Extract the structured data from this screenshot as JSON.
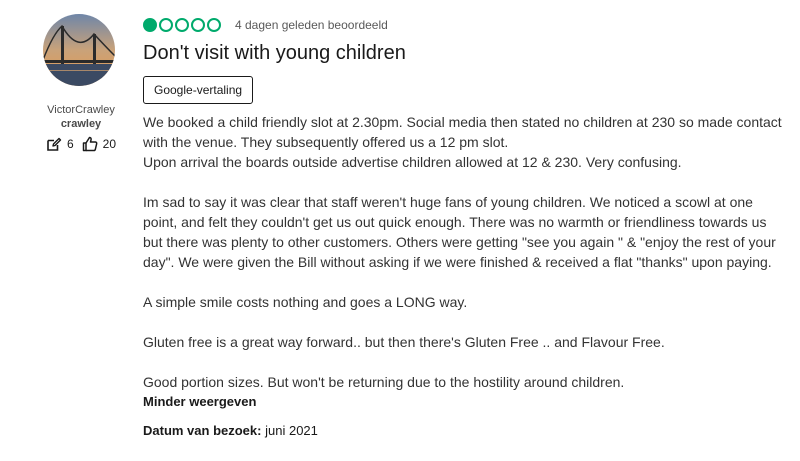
{
  "reviewer": {
    "name": "VictorCrawley",
    "handle": "crawley",
    "contributions": "6",
    "helpful_votes": "20"
  },
  "review": {
    "rating": 1,
    "rating_max": 5,
    "date_text": "4 dagen geleden beoordeeld",
    "title": "Don't visit with young children",
    "translate_label": "Google-vertaling",
    "paragraphs": [
      "We booked a child friendly slot at 2.30pm. Social media then stated no children at 230 so made contact with the venue. They subsequently offered us a 12 pm slot.",
      "Upon arrival the boards outside advertise children allowed at 12 & 230. Very confusing.",
      "Im sad to say it was clear that staff weren't huge fans of young children. We noticed a scowl at one point, and felt they couldn't get us out quick enough. There was no warmth or friendliness towards us but there was plenty to other customers. Others were getting \"see you again \" & \"enjoy the rest of your day\". We were given the Bill without asking if we were finished & received a flat \"thanks\" upon paying.",
      "A simple smile costs nothing and goes a LONG way.",
      "Gluten free is a great way forward.. but then there's Gluten Free .. and Flavour Free.",
      "Good portion sizes. But won't be returning due to the hostility around children."
    ],
    "show_less_label": "Minder weergeven",
    "visit_label": "Datum van bezoek:",
    "visit_value": "juni 2021"
  },
  "colors": {
    "bubble": "#00aa6c",
    "text": "#333333"
  },
  "icons": {
    "contributions": "edit-icon",
    "helpful": "thumbs-up-icon"
  }
}
